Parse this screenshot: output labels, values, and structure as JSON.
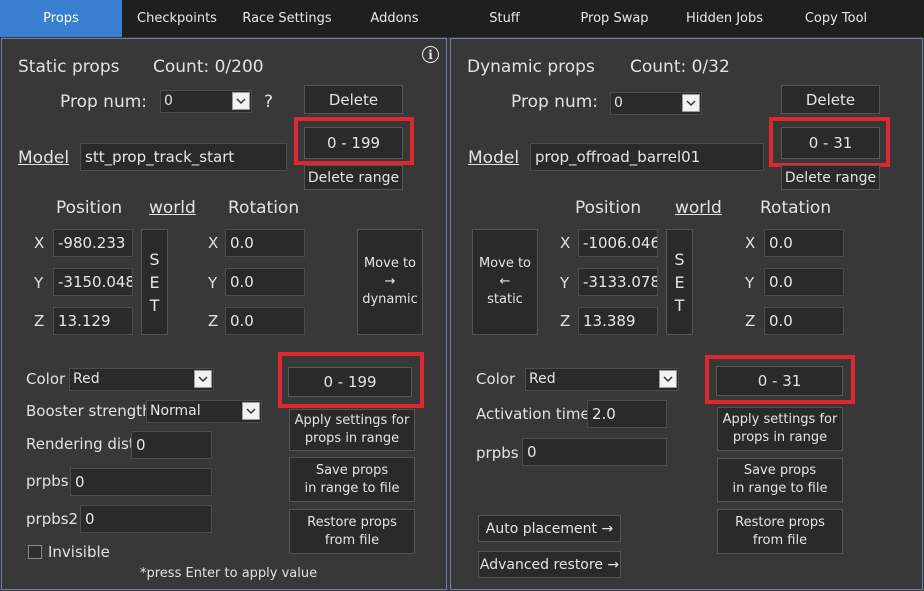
{
  "tabs": [
    "Props",
    "Checkpoints",
    "Race Settings",
    "Addons",
    "Stuff",
    "Prop Swap",
    "Hidden Jobs",
    "Copy Tool"
  ],
  "colors": {
    "accent": "#3a7fd0",
    "highlight": "#e0262e",
    "panel_border": "#6f7fa8"
  },
  "static": {
    "title": "Static props",
    "count": "Count: 0/200",
    "prop_num_label": "Prop num:",
    "prop_num_value": "0",
    "help": "?",
    "delete_label": "Delete",
    "range_value": "0  -  199",
    "delete_range_label": "Delete range",
    "model_label": "Model",
    "model_value": "stt_prop_track_start",
    "position_label": "Position",
    "world_label": "world",
    "rotation_label": "Rotation",
    "axis_x": "X",
    "axis_y": "Y",
    "axis_z": "Z",
    "pos_x": "-980.233",
    "pos_y": "-3150.048",
    "pos_z": "13.129",
    "set_label": "S\nE\nT",
    "rot_x": "0.0",
    "rot_y": "0.0",
    "rot_z": "0.0",
    "move_label": "Move to\n→\ndynamic",
    "color_label": "Color",
    "color_value": "Red",
    "range_value_2": "0  -  199",
    "booster_label": "Booster strength",
    "booster_value": "Normal",
    "apply_label": "Apply settings for\nprops in range",
    "render_label": "Rendering dist",
    "render_value": "0",
    "prpbs_label": "prpbs",
    "prpbs_value": "0",
    "save_label": "Save props\nin range to file",
    "prpbs2_label": "prpbs2",
    "prpbs2_value": "0",
    "restore_label": "Restore props\nfrom file",
    "invisible_label": "Invisible",
    "footer_note": "*press Enter to apply value"
  },
  "dynamic": {
    "title": "Dynamic props",
    "count": "Count: 0/32",
    "prop_num_label": "Prop num:",
    "prop_num_value": "0",
    "delete_label": "Delete",
    "range_value": "0  -  31",
    "delete_range_label": "Delete range",
    "model_label": "Model",
    "model_value": "prop_offroad_barrel01",
    "position_label": "Position",
    "world_label": "world",
    "rotation_label": "Rotation",
    "axis_x": "X",
    "axis_y": "Y",
    "axis_z": "Z",
    "pos_x": "-1006.046",
    "pos_y": "-3133.078",
    "pos_z": "13.389",
    "set_label": "S\nE\nT",
    "rot_x": "0.0",
    "rot_y": "0.0",
    "rot_z": "0.0",
    "move_label": "Move to\n←\nstatic",
    "color_label": "Color",
    "color_value": "Red",
    "range_value_2": "0  -  31",
    "activation_label": "Activation time",
    "activation_value": "2.0",
    "apply_label": "Apply settings for\nprops in range",
    "prpbs_label": "prpbs",
    "prpbs_value": "0",
    "save_label": "Save props\nin range to file",
    "auto_label": "Auto placement →",
    "restore_label": "Restore props\nfrom file",
    "advanced_label": "Advanced restore →"
  }
}
